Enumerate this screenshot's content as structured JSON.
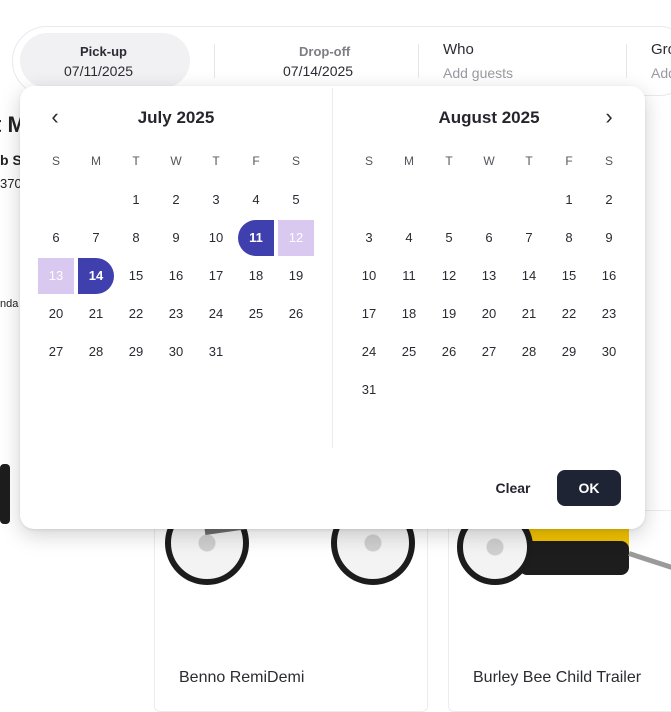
{
  "search": {
    "pickup": {
      "label": "Pick-up",
      "value": "07/11/2025"
    },
    "dropoff": {
      "label": "Drop-off",
      "value": "07/14/2025"
    },
    "who": {
      "label": "Who",
      "placeholder": "Add guests"
    },
    "group": {
      "label": "Gro",
      "placeholder": "Add"
    }
  },
  "background": {
    "partial_title": "t M",
    "partial_line1": "b S",
    "partial_line2": "370",
    "partial_line3": "nda"
  },
  "products": [
    {
      "name": "Benno RemiDemi"
    },
    {
      "name": "Burley Bee Child Trailer"
    }
  ],
  "calendar": {
    "prev_icon": "chevron-left-icon",
    "next_icon": "chevron-right-icon",
    "weekdays": [
      "S",
      "M",
      "T",
      "W",
      "T",
      "F",
      "S"
    ],
    "months": [
      {
        "title": "July 2025",
        "first_weekday": 2,
        "days": 31,
        "range_start": 11,
        "range_end": 14
      },
      {
        "title": "August 2025",
        "first_weekday": 5,
        "days": 31
      }
    ],
    "clear_label": "Clear",
    "ok_label": "OK",
    "colors": {
      "selected": "#3f3fae",
      "in_range": "#d9c8ef",
      "ok_button": "#1e2433"
    }
  }
}
